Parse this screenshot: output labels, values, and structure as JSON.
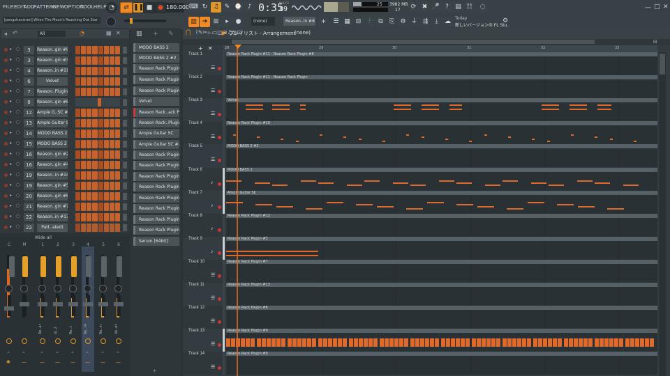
{
  "menu": [
    "FILE",
    "EDIT",
    "ADD",
    "PATTERN",
    "VIEW",
    "OPTION",
    "TOOL",
    "HELP"
  ],
  "transport": {
    "tempo": "180.000",
    "time_main": "0:35",
    "time_sub": "89",
    "time_unit": "M:S:CS",
    "pattern": "Reason..in #8",
    "cpu": "3982 MB",
    "poly": "17",
    "cpu_num": "25",
    "none": "(none)"
  },
  "hint": {
    "title": "[pengshansiren] When The Moon's Reaching Out Star",
    "news_title": "Today",
    "news_body": "新しいバージョンの FL Stu.."
  },
  "channel_filter": "All",
  "channels": [
    {
      "num": "3",
      "name": "Reason..gin #9"
    },
    {
      "num": "3",
      "name": "Reason..gin #3"
    },
    {
      "num": "4",
      "name": "Reason..in #11"
    },
    {
      "num": "6",
      "name": "Velvet"
    },
    {
      "num": "7",
      "name": "Reason..Plugin"
    },
    {
      "num": "8",
      "name": "Reason..gin #8"
    },
    {
      "num": "12",
      "name": "Ample G..SC #2"
    },
    {
      "num": "13",
      "name": "Ample Guitar SC"
    },
    {
      "num": "14",
      "name": "MODO BASS 2"
    },
    {
      "num": "15",
      "name": "MODO BASS 2 #2"
    },
    {
      "num": "16",
      "name": "Reason..gin #2"
    },
    {
      "num": "16",
      "name": "Reason..gin #4"
    },
    {
      "num": "19",
      "name": "Reason..in #14"
    },
    {
      "num": "19",
      "name": "Reason..gin #5"
    },
    {
      "num": "20",
      "name": "Reason..gin #6"
    },
    {
      "num": "21",
      "name": "Reason..gin #7"
    },
    {
      "num": "22",
      "name": "Reason..in #13"
    },
    {
      "num": "22",
      "name": "Patt..ated)"
    }
  ],
  "mixer": {
    "label": "Wide all",
    "strips": [
      "C",
      "M",
      "1",
      "2",
      "3",
      "4",
      "5",
      "6"
    ],
    "names": [
      "",
      "",
      "Re..ar",
      "Jo..2",
      "Re..t",
      "Re..t4",
      "Re..in",
      "Ve..et"
    ]
  },
  "picker": [
    "MODO BASS 2",
    "MODO BASS 2 #2",
    "Reason Rack Plugin #9",
    "Reason Rack Plugin #3",
    "Reason Rack Plugin #8",
    "Velvet",
    "Reason Rack..ack Plugin",
    "Reason Rack..Plugin #8",
    "Ample Guitar SC",
    "Ample Guitar SC #2",
    "Reason Rack Plugin #4",
    "Reason Rack Plugin #4",
    "Reason Rack Plugin #5",
    "Reason Rack Plugin #6",
    "Reason Rack Plugin #7",
    "Reason Rack Plugin #13",
    "Reason Rack Plugin #10",
    "Reason Rack Plugin #12",
    "Serum [64bit]"
  ],
  "playlist": {
    "title": "プレイリスト - Arrangement",
    "pattern": "(none)",
    "bars": [
      "28",
      "29",
      "30",
      "31",
      "32",
      "33"
    ]
  },
  "tracks": [
    {
      "name": "Track 1",
      "clip": "Reason Rack Plugin #11 - Reason Rack Plugin #8"
    },
    {
      "name": "Track 2",
      "clip": "Reason Rack Plugin #11 - Reason Rack Plugin"
    },
    {
      "name": "Track 3",
      "clip": "Velvet"
    },
    {
      "name": "Track 4",
      "clip": "Reason Rack Plugin #10"
    },
    {
      "name": "Track 5",
      "clip": "MODO BASS 2 #2"
    },
    {
      "name": "Track 6",
      "clip": "MODO BASS 2"
    },
    {
      "name": "Track 7",
      "clip": "Ample Guitar SC"
    },
    {
      "name": "Track 8",
      "clip": "Reason Rack Plugin #12"
    },
    {
      "name": "Track 9",
      "clip": "Reason Rack Plugin #3"
    },
    {
      "name": "Track 10",
      "clip": "Reason Rack Plugin #7"
    },
    {
      "name": "Track 11",
      "clip": "Reason Rack Plugin #13"
    },
    {
      "name": "Track 12",
      "clip": "Reason Rack Plugin #6"
    },
    {
      "name": "Track 13",
      "clip": "Reason Rack Plugin #9"
    },
    {
      "name": "Track 14",
      "clip": "Reason Rack Plugin #9"
    }
  ],
  "colors": {
    "accent": "#f08a24",
    "note": "#e06a2a",
    "panel": "#2b3337"
  }
}
